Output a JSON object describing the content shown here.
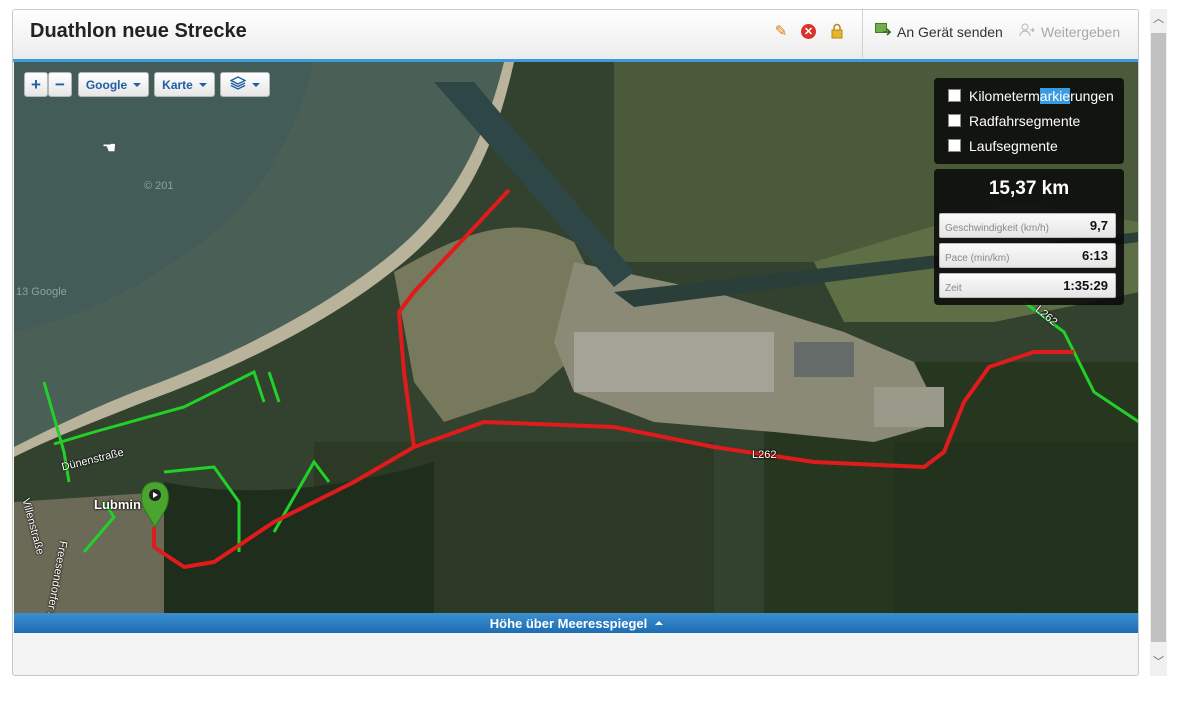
{
  "header": {
    "title": "Duathlon neue Strecke",
    "send_label": "An Gerät senden",
    "share_label": "Weitergeben"
  },
  "map_controls": {
    "zoom_in": "+",
    "zoom_out": "−",
    "provider": "Google",
    "map_type": "Karte"
  },
  "layers": {
    "km_markers_pre": "Kilometerm",
    "km_markers_sel": "arkie",
    "km_markers_post": "rungen",
    "bike_segments": "Radfahrsegmente",
    "run_segments": "Laufsegmente"
  },
  "stats": {
    "distance": "15,37 km",
    "speed_label": "Geschwindigkeit (km/h)",
    "speed_value": "9,7",
    "pace_label": "Pace (min/km)",
    "pace_value": "6:13",
    "time_label": "Zeit",
    "time_value": "1:35:29"
  },
  "map_labels": {
    "town": "Lubmin",
    "street_1": "Dünenstraße",
    "street_2": "Villenstraße",
    "street_3": "Freesendorfer Str.",
    "road_1": "L262",
    "road_2": "L262",
    "watermark_1": "© 201",
    "watermark_2": "13 Google"
  },
  "elevation": {
    "label": "Höhe über Meeresspiegel"
  },
  "colors": {
    "accent": "#3a9be0",
    "route": "#e01b1b",
    "path": "#22d02a"
  }
}
